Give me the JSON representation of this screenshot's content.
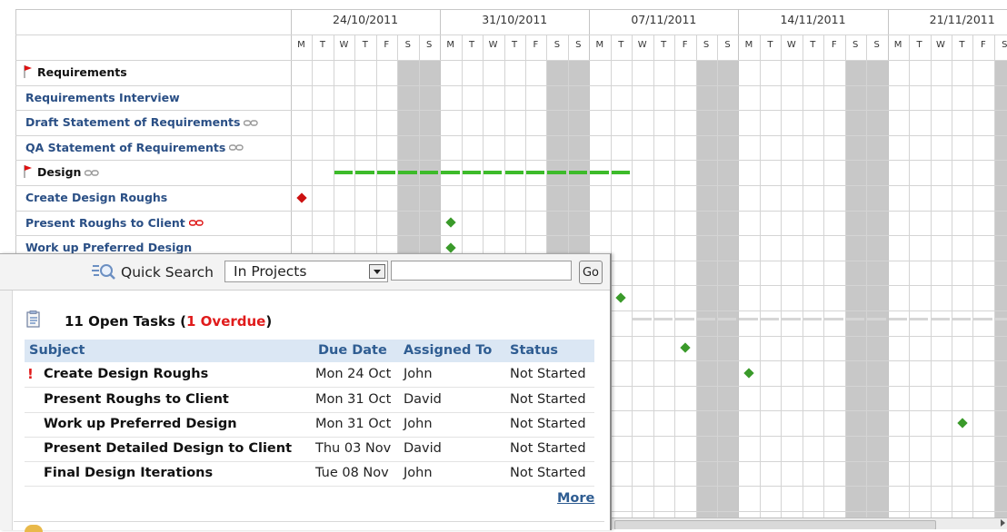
{
  "gantt": {
    "weeks": [
      "24/10/2011",
      "31/10/2011",
      "07/11/2011",
      "14/11/2011",
      "21/11/2011"
    ],
    "day_letters": [
      "M",
      "T",
      "W",
      "T",
      "F",
      "S",
      "S"
    ],
    "tasks": [
      {
        "name": "Requirements",
        "summary": true,
        "dependency": false,
        "dep_red": false
      },
      {
        "name": "Requirements Interview",
        "summary": false,
        "dependency": false,
        "dep_red": false
      },
      {
        "name": "Draft Statement of Requirements",
        "summary": false,
        "dependency": true,
        "dep_red": false
      },
      {
        "name": "QA Statement of Requirements",
        "summary": false,
        "dependency": true,
        "dep_red": false
      },
      {
        "name": "Design",
        "summary": true,
        "dependency": true,
        "dep_red": false
      },
      {
        "name": "Create Design Roughs",
        "summary": false,
        "dependency": false,
        "dep_red": false
      },
      {
        "name": "Present Roughs to Client",
        "summary": false,
        "dependency": true,
        "dep_red": true
      },
      {
        "name": "Work up Preferred Design",
        "summary": false,
        "dependency": false,
        "dep_red": false
      }
    ],
    "colors": {
      "milestone_green": "#3a9a2a",
      "milestone_red": "#cc1111",
      "bar_green": "#3dbb2a",
      "weekend": "#c8c8c8"
    }
  },
  "search": {
    "label": "Quick Search",
    "scope": "In Projects",
    "query": "",
    "go_label": "Go"
  },
  "tasks_widget": {
    "title_prefix": "11 Open Tasks (",
    "overdue": "1 Overdue",
    "title_suffix": ")",
    "columns": [
      "Subject",
      "Due Date",
      "Assigned To",
      "Status"
    ],
    "rows": [
      {
        "overdue": "!",
        "subject": "Create Design Roughs",
        "due": "Mon 24 Oct",
        "assigned": "John",
        "status": "Not Started"
      },
      {
        "overdue": "",
        "subject": "Present Roughs to Client",
        "due": "Mon 31 Oct",
        "assigned": "David",
        "status": "Not Started"
      },
      {
        "overdue": "",
        "subject": "Work up Preferred Design",
        "due": "Mon 31 Oct",
        "assigned": "John",
        "status": "Not Started"
      },
      {
        "overdue": "",
        "subject": "Present Detailed Design to Client",
        "due": "Thu 03 Nov",
        "assigned": "David",
        "status": "Not Started"
      },
      {
        "overdue": "",
        "subject": "Final Design Iterations",
        "due": "Tue 08 Nov",
        "assigned": "John",
        "status": "Not Started"
      }
    ],
    "more_label": "More"
  }
}
